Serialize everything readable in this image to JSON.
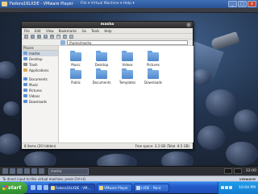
{
  "vmware": {
    "title": "Fedora16LXDE - VMware Player",
    "menu": "File  ▾  Virtual Machine  ▾  Help  ▾",
    "controls": [
      "_",
      "□",
      "x"
    ],
    "hint": "To direct input to this virtual machine, press Ctrl+G.",
    "brand": "vmware"
  },
  "file_manager": {
    "title": "masha",
    "close": "x",
    "menu": [
      "File",
      "Edit",
      "View",
      "Bookmarks",
      "Go",
      "Tools",
      "Help"
    ],
    "path": "/home/masha",
    "places_header": "Places",
    "places": [
      "masha",
      "Desktop",
      "Trash",
      "Applications",
      "Documents",
      "Music",
      "Pictures",
      "Videos",
      "Downloads"
    ],
    "items": [
      "Music",
      "Desktop",
      "Videos",
      "Pictures",
      "Public",
      "Documents",
      "Templates",
      "Downloads"
    ],
    "status_left": "8 items (20 hidden)",
    "status_right": "Free space: 3.3 GB (Total: 8.5 GB)"
  },
  "guest_panel": {
    "task": "masha",
    "time": "22:00"
  },
  "taskbar": {
    "start": "start",
    "buttons": [
      "Fedora16LXDE - VM...",
      "VMware Player",
      "LXDE - Paint"
    ],
    "clock": "10:04 PM"
  },
  "colors": {
    "xp_blue": "#2259c9",
    "folder_blue": "#4f88c9",
    "start_green": "#2d8a2a"
  }
}
